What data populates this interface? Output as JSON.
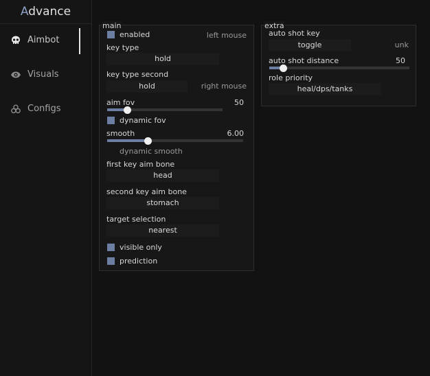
{
  "app": {
    "title_first": "A",
    "title_rest": "dvance"
  },
  "sidebar": {
    "items": [
      {
        "label": "Aimbot",
        "icon": "skull-icon",
        "active": true
      },
      {
        "label": "Visuals",
        "icon": "eye-icon",
        "active": false
      },
      {
        "label": "Configs",
        "icon": "biohazard-icon",
        "active": false
      }
    ]
  },
  "main_panel": {
    "title": "main",
    "enabled": {
      "label": "enabled",
      "checked": true,
      "bind_key": "left mouse"
    },
    "key_type": {
      "label": "key type",
      "value": "hold"
    },
    "key_type_second": {
      "label": "key type second",
      "value": "hold",
      "bind_key": "right mouse"
    },
    "aim_fov": {
      "label": "aim fov",
      "value": "50",
      "fraction": 0.17
    },
    "dynamic_fov": {
      "label": "dynamic fov",
      "checked": true
    },
    "smooth": {
      "label": "smooth",
      "value": "6.00",
      "fraction": 0.3
    },
    "dynamic_smooth": {
      "label": "dynamic smooth"
    },
    "first_key_aim_bone": {
      "label": "first key aim bone",
      "value": "head"
    },
    "second_key_aim_bone": {
      "label": "second key aim bone",
      "value": "stomach"
    },
    "target_selection": {
      "label": "target selection",
      "value": "nearest"
    },
    "visible_only": {
      "label": "visible only",
      "checked": true
    },
    "prediction": {
      "label": "prediction",
      "checked": true
    }
  },
  "extra_panel": {
    "title": "extra",
    "auto_shot_key": {
      "label": "auto shot key",
      "value": "toggle",
      "bind_key": "unk"
    },
    "auto_shot_distance": {
      "label": "auto shot distance",
      "value": "50",
      "fraction": 0.1
    },
    "role_priority": {
      "label": "role priority",
      "value": "heal/dps/tanks"
    }
  },
  "colors": {
    "accent": "#6d7ea3",
    "background": "#121212",
    "panel": "#171717"
  }
}
